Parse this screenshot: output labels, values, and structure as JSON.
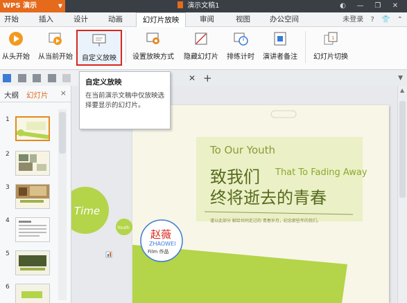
{
  "app": {
    "name": "WPS 演示",
    "doc_title": "演示文稿1"
  },
  "window": {
    "login": "未登录"
  },
  "menu": {
    "tabs": [
      {
        "label": "开始",
        "active": false
      },
      {
        "label": "插入",
        "active": false
      },
      {
        "label": "设计",
        "active": false
      },
      {
        "label": "动画",
        "active": false
      },
      {
        "label": "幻灯片放映",
        "active": true
      },
      {
        "label": "审阅",
        "active": false
      },
      {
        "label": "视图",
        "active": false
      },
      {
        "label": "办公空间",
        "active": false
      }
    ]
  },
  "ribbon": {
    "from_start": "从头开始",
    "from_current": "从当前开始",
    "custom_show": "自定义放映",
    "setup_show": "设置放映方式",
    "hide_slide": "隐藏幻灯片",
    "rehearse": "排练计时",
    "presenter_notes": "演讲者备注",
    "transition": "幻灯片切换"
  },
  "tooltip": {
    "title": "自定义放映",
    "desc": "在当前演示文稿中仅放映选择要显示的幻灯片。"
  },
  "left_pane": {
    "tab_outline": "大纲",
    "tab_slides": "幻灯片",
    "close": "×",
    "thumbs": [
      "1",
      "2",
      "3",
      "4",
      "5",
      "6"
    ]
  },
  "slide": {
    "time_text": "Time",
    "youth_text": "Youth",
    "heading_en": "To Our Youth",
    "line1": "致我们",
    "line1_en": "That To Fading Away",
    "line2": "终将逝去的青春",
    "small_text": "谨以此部分 献给共同走过的 青春岁月，纪念那些年的我们。",
    "seal_name": "赵薇",
    "seal_en": "ZHAOWEI",
    "seal_sub": "Film 作品"
  },
  "colors": {
    "accent": "#e56a1c",
    "title_dark": "#3a3f45",
    "slide_bg": "#f8f6e7",
    "green": "#b4d44a",
    "selected_border": "#d9261c"
  }
}
